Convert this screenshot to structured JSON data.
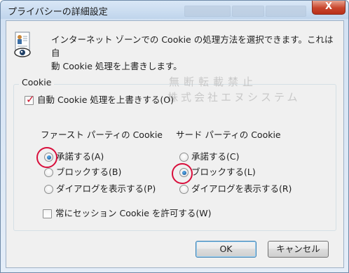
{
  "window": {
    "title": "プライバシーの詳細設定",
    "close_label": "X"
  },
  "description": {
    "line1": "インターネット ゾーンでの Cookie の処理方法を選択できます。これは自",
    "line2": "動 Cookie 処理を上書きします。"
  },
  "group": {
    "title": "Cookie",
    "override_label": "自動 Cookie 処理を上書きする(O)",
    "override_checked": true
  },
  "first_party": {
    "heading": "ファースト パーティの Cookie",
    "options": [
      "承諾する(A)",
      "ブロックする(B)",
      "ダイアログを表示する(P)"
    ],
    "selected": "承諾する(A)"
  },
  "third_party": {
    "heading": "サード パーティの Cookie",
    "options": [
      "承諾する(C)",
      "ブロックする(L)",
      "ダイアログを表示する(R)"
    ],
    "selected": "ブロックする(L)"
  },
  "session": {
    "label": "常にセッション Cookie を許可する(W)",
    "checked": false
  },
  "watermark": {
    "line1": "無断転載禁止",
    "line2": "株式会社エヌシステム"
  },
  "buttons": {
    "ok": "OK",
    "cancel": "キャンセル"
  },
  "colors": {
    "highlight_circle": "#d80f3c",
    "check_mark": "#d0142c"
  }
}
